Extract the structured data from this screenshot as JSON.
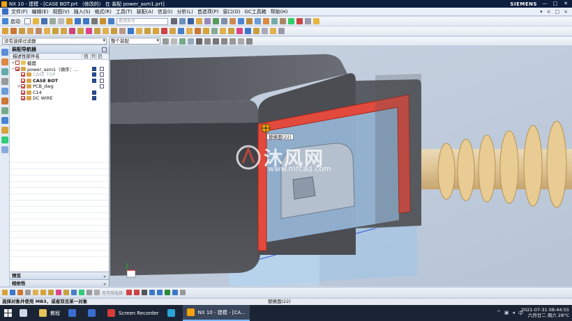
{
  "window": {
    "title": "NX 10 - 建模 - [CASE BOT.prt （修改的） 在 装配 power_asm1.prt]",
    "brand": "SIEMENS",
    "controls": [
      "—",
      "□",
      "✕"
    ]
  },
  "menubar": {
    "items": [
      "文件(F)",
      "编辑(E)",
      "视图(V)",
      "插入(S)",
      "格式(R)",
      "工具(T)",
      "装配(A)",
      "信息(I)",
      "分析(L)",
      "首选项(P)",
      "窗口(O)",
      "GC工具箱",
      "帮助(H)"
    ],
    "right_controls": [
      "▾",
      "×",
      "□",
      "×"
    ]
  },
  "toolbar1": {
    "start_label": "启动",
    "command_search_placeholder": "查找命令"
  },
  "toolbar3": {
    "selection_filter": "没有选择过滤器",
    "scope": "整个装配"
  },
  "navigator": {
    "title": "装配导航器",
    "columns": [
      "描述性部件名",
      "信",
      "只",
      "已"
    ],
    "rows": [
      {
        "label": "截面",
        "indent": 0,
        "expand": "+",
        "checked": false,
        "style": "folder",
        "marks": []
      },
      {
        "label": "power_asm1（顺序：...",
        "indent": 0,
        "expand": "−",
        "checked": true,
        "style": "normal",
        "marks": [
          "blue",
          "doc"
        ]
      },
      {
        "label": "CASE TOP",
        "indent": 1,
        "expand": "",
        "checked": true,
        "style": "dim",
        "marks": [
          "blue",
          "doc"
        ]
      },
      {
        "label": "CASE BOT",
        "indent": 1,
        "expand": "",
        "checked": true,
        "style": "bold",
        "marks": [
          "blue",
          "doc"
        ]
      },
      {
        "label": "PCB_dwg",
        "indent": 1,
        "expand": "+",
        "checked": true,
        "style": "normal",
        "marks": [
          "doc"
        ]
      },
      {
        "label": "C14",
        "indent": 1,
        "expand": "",
        "checked": true,
        "style": "normal",
        "marks": [
          "blue"
        ]
      },
      {
        "label": "DC WIRE",
        "indent": 1,
        "expand": "",
        "checked": true,
        "style": "normal",
        "marks": [
          "blue"
        ]
      }
    ],
    "panels": [
      "预览",
      "相依性"
    ]
  },
  "viewport": {
    "tooltip": "替换面(22)",
    "watermark_title": "沐风网",
    "watermark_url": "www.mfcad.com",
    "highlight_color": "#e14a3c"
  },
  "statusbar": {
    "combo_placeholder": "无可用选择",
    "cue": "选择对象并使用 MB3，或者双击某一对象",
    "status": "替换面(22)"
  },
  "taskbar": {
    "items": [
      {
        "label": "",
        "icon": "task-view-icon"
      },
      {
        "label": "教程",
        "icon": "folder-icon"
      },
      {
        "label": "",
        "icon": "app-icon"
      },
      {
        "label": "",
        "icon": "app-icon"
      },
      {
        "label": "Screen Recorder",
        "icon": "recorder-icon"
      },
      {
        "label": "",
        "icon": "edge-icon"
      },
      {
        "label": "NX 10 - 建模 - [CA...",
        "icon": "nx-icon"
      }
    ],
    "time": "2021-07-31 08:44:55",
    "date": "六月廿二 周六 28°C"
  }
}
